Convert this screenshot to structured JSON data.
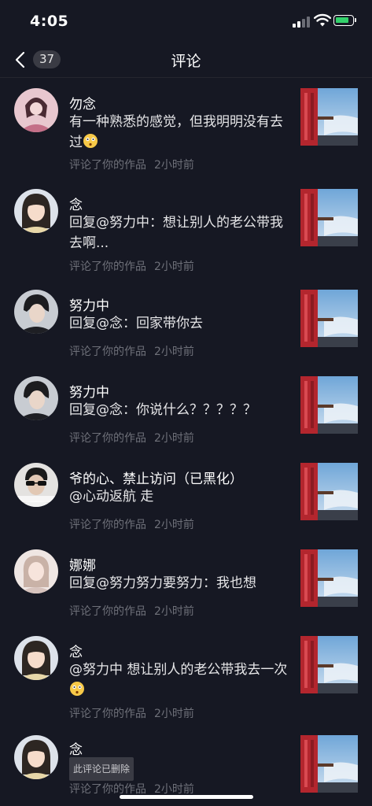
{
  "status": {
    "time": "4:05",
    "accent_battery": "#33d16b"
  },
  "nav": {
    "back_icon": "chevron-left-icon",
    "count": "37",
    "title": "评论"
  },
  "comments": [
    {
      "name": "勿念",
      "text": "有一种熟悉的感觉，但我明明没有去过",
      "emoji": "flushed-face-emoji",
      "action": "评论了你的作品",
      "time": "2小时前",
      "avatar": "avatar-pink"
    },
    {
      "name": "念",
      "reply": "回复",
      "mention": "@努力中",
      "text": "：想让别人的老公带我去啊...",
      "action": "评论了你的作品",
      "time": "2小时前",
      "avatar": "avatar-girl"
    },
    {
      "name": "努力中",
      "reply": "回复",
      "mention": "@念",
      "text": "：回家带你去",
      "action": "评论了你的作品",
      "time": "2小时前",
      "avatar": "avatar-boy"
    },
    {
      "name": "努力中",
      "reply": "回复",
      "mention": "@念",
      "text": "：你说什么？？？？？",
      "action": "评论了你的作品",
      "time": "2小时前",
      "avatar": "avatar-boy"
    },
    {
      "name": "爷的心、禁止访问（已黑化）",
      "mention": "@心动返航",
      "text": " 走",
      "action": "评论了你的作品",
      "time": "2小时前",
      "avatar": "avatar-sunglasses"
    },
    {
      "name": "娜娜",
      "reply": "回复",
      "mention": "@努力努力要努力",
      "text": "：我也想",
      "action": "评论了你的作品",
      "time": "2小时前",
      "avatar": "avatar-light"
    },
    {
      "name": "念",
      "mention": "@努力中",
      "text": " 想让别人的老公带我去一次",
      "emoji": "flushed-face-emoji",
      "action": "评论了你的作品",
      "time": "2小时前",
      "avatar": "avatar-girl"
    },
    {
      "name": "念",
      "deleted": "此评论已删除",
      "action": "评论了你的作品",
      "time": "2小时前",
      "avatar": "avatar-girl"
    }
  ]
}
